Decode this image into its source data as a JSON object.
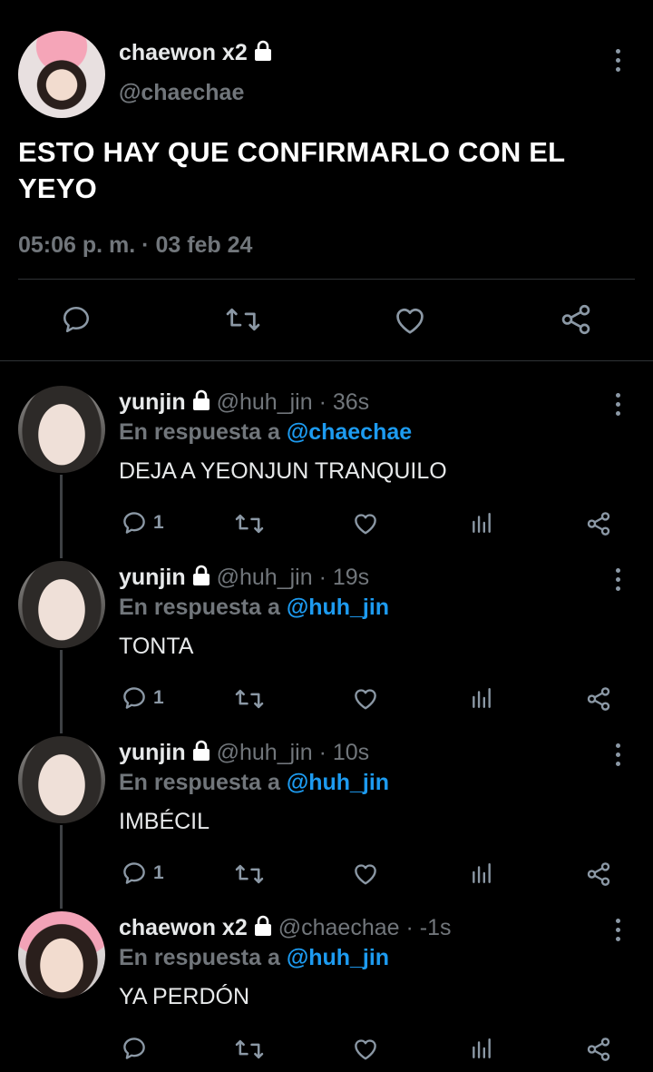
{
  "main_tweet": {
    "name": "chaewon x2",
    "handle": "@chaechae",
    "text": "ESTO HAY QUE CONFIRMARLO CON EL YEYO",
    "timestamp": "05:06 p. m. · 03 feb 24"
  },
  "replies": [
    {
      "name": "yunjin",
      "handle": "@huh_jin",
      "time": "· 36s",
      "in_reply_prefix": "En respuesta a",
      "in_reply_to": "@chaechae",
      "text": "DEJA A YEONJUN TRANQUILO",
      "reply_count": "1",
      "avatar": "yunjin-avatar"
    },
    {
      "name": "yunjin",
      "handle": "@huh_jin",
      "time": "· 19s",
      "in_reply_prefix": "En respuesta a",
      "in_reply_to": "@huh_jin",
      "text": "TONTA",
      "reply_count": "1",
      "avatar": "yunjin-avatar"
    },
    {
      "name": "yunjin",
      "handle": "@huh_jin",
      "time": "· 10s",
      "in_reply_prefix": "En respuesta a",
      "in_reply_to": "@huh_jin",
      "text": "IMBÉCIL",
      "reply_count": "1",
      "avatar": "yunjin-avatar"
    },
    {
      "name": "chaewon x2",
      "handle": "@chaechae",
      "time": "· -1s",
      "in_reply_prefix": "En respuesta a",
      "in_reply_to": "@huh_jin",
      "text": "YA PERDÓN",
      "reply_count": "",
      "avatar": "chaewon-avatar"
    }
  ],
  "colors": {
    "background": "#000000",
    "mention": "#1d9bf0",
    "muted": "#71767b"
  },
  "icons": [
    "comment-icon",
    "retweet-icon",
    "like-icon",
    "share-icon",
    "analytics-icon",
    "lock-icon",
    "more-options-icon"
  ]
}
